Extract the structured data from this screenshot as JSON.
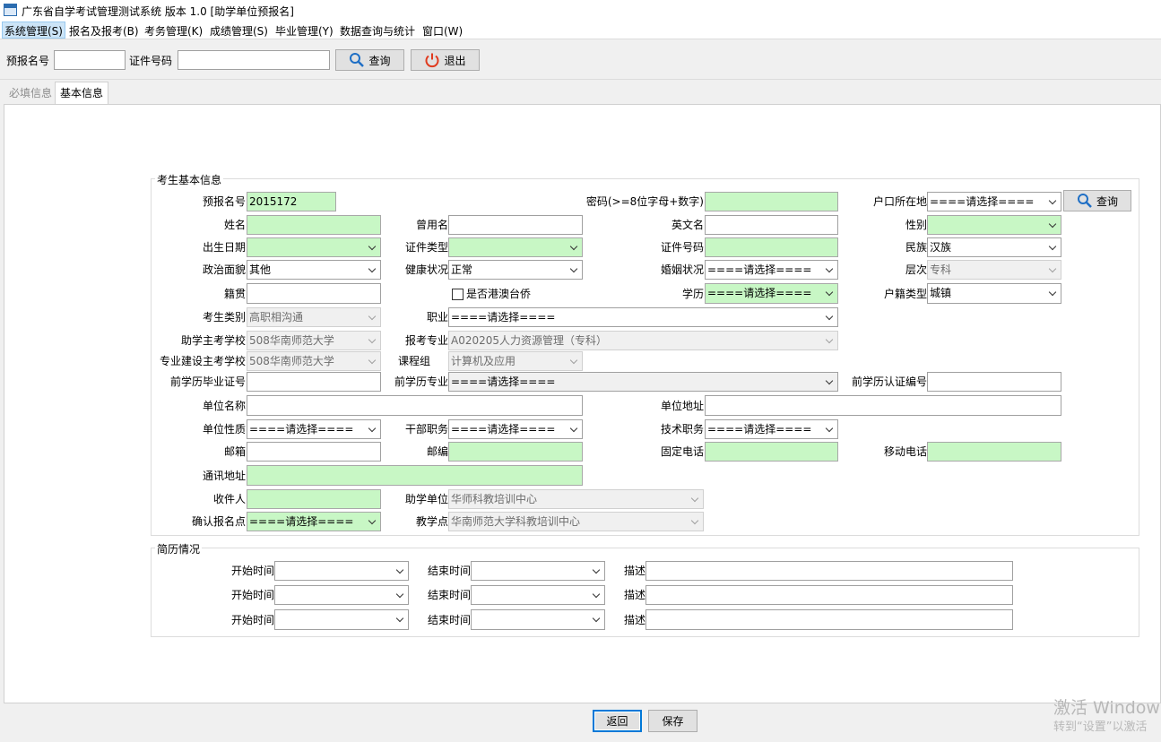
{
  "window": {
    "title": "广东省自学考试管理测试系统 版本 1.0  [助学单位预报名]"
  },
  "menu": [
    "系统管理(S)",
    "报名及报考(B)",
    "考务管理(K)",
    "成绩管理(S)",
    "毕业管理(Y)",
    "数据查询与统计",
    "窗口(W)"
  ],
  "toolbar": {
    "pre_reg_label": "预报名号",
    "pre_reg_value": "",
    "id_no_label": "证件号码",
    "id_no_value": "",
    "query_label": "查询",
    "exit_label": "退出"
  },
  "tabs": [
    {
      "label": "必填信息",
      "enabled": false
    },
    {
      "label": "基本信息",
      "enabled": true,
      "selected": true
    }
  ],
  "basic": {
    "group_title": "考生基本信息",
    "pre_reg_no_label": "预报名号",
    "pre_reg_no_value": "2015172",
    "password_label": "密码(>=8位字母+数字)",
    "password_value": "",
    "residence_label": "户口所在地",
    "residence_value": "====请选择====",
    "residence_query_label": "查询",
    "name_label": "姓名",
    "name_value": "",
    "former_name_label": "曾用名",
    "former_name_value": "",
    "english_name_label": "英文名",
    "english_name_value": "",
    "gender_label": "性别",
    "gender_value": "",
    "birth_label": "出生日期",
    "birth_value": "",
    "id_type_label": "证件类型",
    "id_type_value": "",
    "id_no_label": "证件号码",
    "id_no_value": "",
    "ethnicity_label": "民族",
    "ethnicity_value": "汉族",
    "political_label": "政治面貌",
    "political_value": "其他",
    "health_label": "健康状况",
    "health_value": "正常",
    "marital_label": "婚姻状况",
    "marital_value": "====请选择====",
    "level_label": "层次",
    "level_value": "专科",
    "native_label": "籍贯",
    "native_value": "",
    "hk_tw_label": "是否港澳台侨",
    "education_label": "学历",
    "education_value": "====请选择====",
    "hukou_type_label": "户籍类型",
    "hukou_type_value": "城镇",
    "category_label": "考生类别",
    "category_value": "高职相沟通",
    "occupation_label": "职业",
    "occupation_value": "====请选择====",
    "school_label": "助学主考学校",
    "school_value": "508华南师范大学",
    "major_label": "报考专业",
    "major_value": "A020205人力资源管理（专科）",
    "spec_school_label": "专业建设主考学校",
    "spec_school_value": "508华南师范大学",
    "course_group_label": "课程组",
    "course_group_value": "计算机及应用",
    "prev_cert_label": "前学历毕业证号",
    "prev_cert_value": "",
    "prev_major_label": "前学历专业",
    "prev_major_value": "====请选择====",
    "prev_verify_label": "前学历认证编号",
    "prev_verify_value": "",
    "employer_label": "单位名称",
    "employer_value": "",
    "employer_addr_label": "单位地址",
    "employer_addr_value": "",
    "employer_type_label": "单位性质",
    "employer_type_value": "====请选择====",
    "cadre_label": "干部职务",
    "cadre_value": "====请选择====",
    "tech_label": "技术职务",
    "tech_value": "====请选择====",
    "email_label": "邮箱",
    "email_value": "",
    "postcode_label": "邮编",
    "postcode_value": "",
    "phone_label": "固定电话",
    "phone_value": "",
    "mobile_label": "移动电话",
    "mobile_value": "",
    "address_label": "通讯地址",
    "address_value": "",
    "recipient_label": "收件人",
    "recipient_value": "",
    "assist_unit_label": "助学单位",
    "assist_unit_value": "华师科教培训中心",
    "confirm_point_label": "确认报名点",
    "confirm_point_value": "====请选择====",
    "teach_point_label": "教学点",
    "teach_point_value": "华南师范大学科教培训中心"
  },
  "resume": {
    "group_title": "简历情况",
    "rows": [
      {
        "start_label": "开始时间",
        "start_value": "",
        "end_label": "结束时间",
        "end_value": "",
        "desc_label": "描述",
        "desc_value": ""
      },
      {
        "start_label": "开始时间",
        "start_value": "",
        "end_label": "结束时间",
        "end_value": "",
        "desc_label": "描述",
        "desc_value": ""
      },
      {
        "start_label": "开始时间",
        "start_value": "",
        "end_label": "结束时间",
        "end_value": "",
        "desc_label": "描述",
        "desc_value": ""
      }
    ]
  },
  "footer": {
    "back_label": "返回",
    "save_label": "保存"
  },
  "watermark": {
    "line1": "激活 Window",
    "line2": "转到“设置”以激活"
  }
}
